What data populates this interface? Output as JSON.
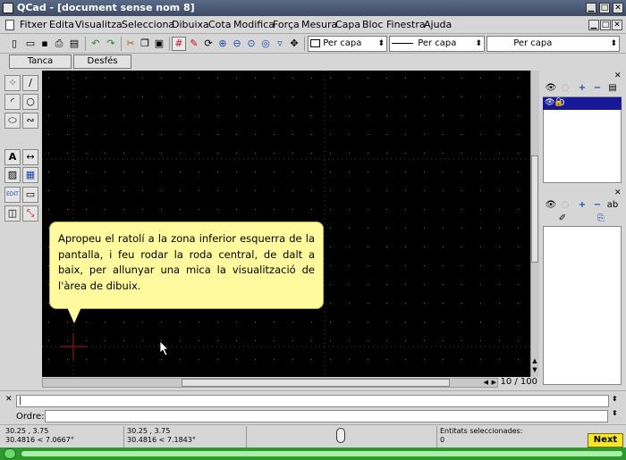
{
  "window": {
    "title": "QCad - [document sense nom 8]",
    "buttons": [
      "▁",
      "□",
      "✕"
    ]
  },
  "menubar": {
    "items": [
      "Fitxer",
      "Edita",
      "Visualitza",
      "Selecciona",
      "Dibuixa",
      "Cota",
      "Modifica",
      "Força",
      "Mesura",
      "Capa",
      "Bloc",
      "Finestra",
      "Ajuda"
    ],
    "mdi_buttons": [
      "▁",
      "□",
      "✕"
    ]
  },
  "toolbar": {
    "color_combo": "Per capa",
    "width_combo": "Per capa",
    "linetype_combo": "Per capa"
  },
  "cad_toolbar": {
    "close_label": "Tanca",
    "undo_label": "Desfés"
  },
  "layers": {
    "items": [
      {
        "name": "0"
      }
    ]
  },
  "command": {
    "history": "|",
    "prompt_label": "Ordre:",
    "input_value": ""
  },
  "status": {
    "abs_coord": "30.25 , 3.75",
    "abs_polar": "30.4816 < 7.0667°",
    "rel_coord": "30.25 , 3.75",
    "rel_polar": "30.4816 < 7.1843°",
    "selected_label": "Entitats seleccionades:",
    "selected_count": "0"
  },
  "pagination": {
    "text": "10 / 100"
  },
  "tutorial": {
    "text": "Apropeu el ratolí a la zona inferior esquerra de la pantalla, i feu rodar la roda central, de dalt a baix, per allunyar una mica la visualització de l'àrea de dibuix.",
    "next_label": "Next"
  },
  "colors": {
    "title_bar": "#4a5876",
    "canvas_bg": "#000000",
    "grid_dot": "#6b6b6b",
    "origin_cross": "#b01818",
    "tooltip_bg": "#fffa9e",
    "layer_selected": "#17199a",
    "progress_green": "#2e9a2e",
    "next_button": "#f5e62a"
  }
}
